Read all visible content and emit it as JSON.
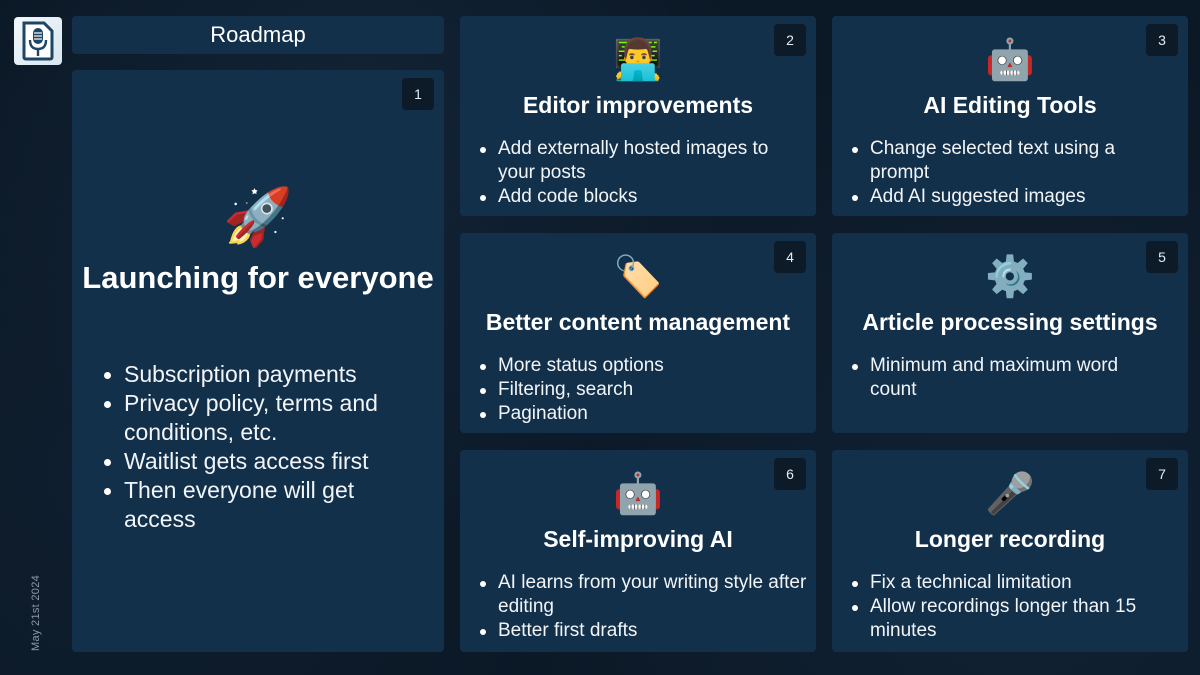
{
  "app": {
    "logo_icon": "document-microphone-icon",
    "date": "May 21st 2024"
  },
  "header": {
    "title": "Roadmap"
  },
  "colors": {
    "background": "#0b1826",
    "card": "#13304b",
    "badge": "#0d1b29",
    "text": "#ffffff"
  },
  "cards": [
    {
      "number": "1",
      "icon": "rocket-icon",
      "emoji": "🚀",
      "title": "Launching for everyone",
      "items": [
        "Subscription payments",
        "Privacy policy, terms and conditions, etc.",
        "Waitlist gets access first",
        "Then everyone will get access"
      ]
    },
    {
      "number": "2",
      "icon": "technologist-icon",
      "emoji": "👨‍💻",
      "title": "Editor improvements",
      "items": [
        "Add externally hosted images to your posts",
        "Add code blocks"
      ]
    },
    {
      "number": "3",
      "icon": "robot-icon",
      "emoji": "🤖",
      "title": "AI Editing Tools",
      "items": [
        "Change selected text using a prompt",
        "Add AI suggested images"
      ]
    },
    {
      "number": "4",
      "icon": "label-tag-icon",
      "emoji": "🏷️",
      "title": "Better content management",
      "items": [
        "More status options",
        "Filtering, search",
        "Pagination"
      ]
    },
    {
      "number": "5",
      "icon": "gear-icon",
      "emoji": "⚙️",
      "title": "Article processing settings",
      "items": [
        "Minimum and maximum word count"
      ]
    },
    {
      "number": "6",
      "icon": "robot-icon",
      "emoji": "🤖",
      "title": "Self-improving AI",
      "items": [
        "AI learns from your writing style after editing",
        "Better first drafts"
      ]
    },
    {
      "number": "7",
      "icon": "microphone-icon",
      "emoji": "🎤",
      "title": "Longer recording",
      "items": [
        "Fix a technical limitation",
        "Allow recordings longer than 15 minutes"
      ]
    }
  ]
}
